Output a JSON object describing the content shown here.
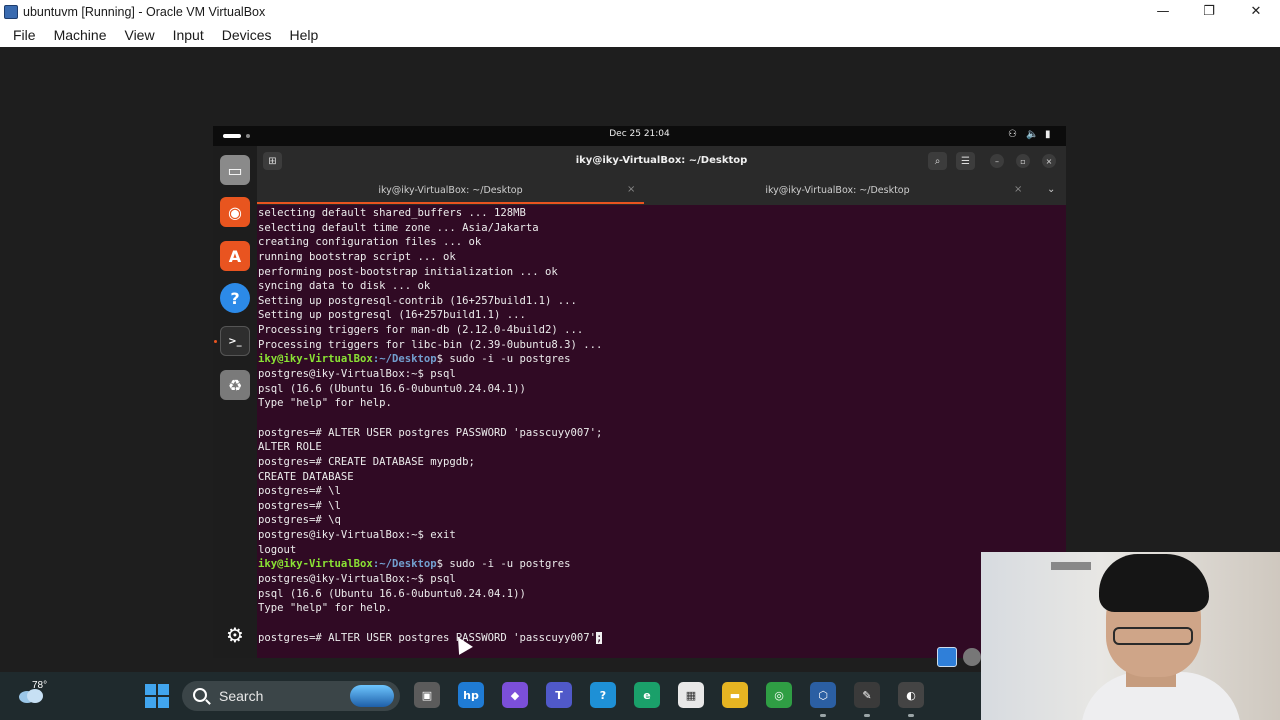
{
  "window": {
    "title": "ubuntuvm [Running] - Oracle VM VirtualBox",
    "minimize": "—",
    "restore": "❐",
    "close": "✕"
  },
  "menu": {
    "items": [
      "File",
      "Machine",
      "View",
      "Input",
      "Devices",
      "Help"
    ]
  },
  "ubuntu_topbar": {
    "clock": "Dec 25  21:04"
  },
  "terminal": {
    "title": "iky@iky-VirtualBox: ~/Desktop",
    "tabs": [
      {
        "label": "iky@iky-VirtualBox: ~/Desktop",
        "active": true
      },
      {
        "label": "iky@iky-VirtualBox: ~/Desktop",
        "active": false
      }
    ],
    "new_tab_icon": "⊞",
    "search_icon": "⌕",
    "menu_icon": "☰",
    "tabs_dropdown_icon": "⌄",
    "tab_close": "×",
    "lines": [
      {
        "text": "selecting default shared_buffers ... 128MB"
      },
      {
        "text": "selecting default time zone ... Asia/Jakarta"
      },
      {
        "text": "creating configuration files ... ok"
      },
      {
        "text": "running bootstrap script ... ok"
      },
      {
        "text": "performing post-bootstrap initialization ... ok"
      },
      {
        "text": "syncing data to disk ... ok"
      },
      {
        "text": "Setting up postgresql-contrib (16+257build1.1) ..."
      },
      {
        "text": "Setting up postgresql (16+257build1.1) ..."
      },
      {
        "text": "Processing triggers for man-db (2.12.0-4build2) ..."
      },
      {
        "text": "Processing triggers for libc-bin (2.39-0ubuntu8.3) ..."
      },
      {
        "user": "iky@iky-VirtualBox",
        "path": ":~/Desktop",
        "text": "$ sudo -i -u postgres"
      },
      {
        "text": "postgres@iky-VirtualBox:~$ psql"
      },
      {
        "text": "psql (16.6 (Ubuntu 16.6-0ubuntu0.24.04.1))"
      },
      {
        "text": "Type \"help\" for help."
      },
      {
        "text": ""
      },
      {
        "text": "postgres=# ALTER USER postgres PASSWORD 'passcuyy007';"
      },
      {
        "text": "ALTER ROLE"
      },
      {
        "text": "postgres=# CREATE DATABASE mypgdb;"
      },
      {
        "text": "CREATE DATABASE"
      },
      {
        "text": "postgres=# \\l"
      },
      {
        "text": "postgres=# \\l"
      },
      {
        "text": "postgres=# \\q"
      },
      {
        "text": "postgres@iky-VirtualBox:~$ exit"
      },
      {
        "text": "logout"
      },
      {
        "user": "iky@iky-VirtualBox",
        "path": ":~/Desktop",
        "text": "$ sudo -i -u postgres"
      },
      {
        "text": "postgres@iky-VirtualBox:~$ psql"
      },
      {
        "text": "psql (16.6 (Ubuntu 16.6-0ubuntu0.24.04.1))"
      },
      {
        "text": "Type \"help\" for help."
      },
      {
        "text": ""
      },
      {
        "text": "postgres=# ALTER USER postgres PASSWORD 'passcuyy007'",
        "cursor": ";"
      }
    ]
  },
  "dock": {
    "items": [
      {
        "name": "files",
        "glyph": "▭",
        "color": "#8a8a8a"
      },
      {
        "name": "firefox",
        "glyph": "◉",
        "color": "#e8551f"
      },
      {
        "name": "app-center",
        "glyph": "A",
        "color": "#e95420"
      },
      {
        "name": "help",
        "glyph": "?",
        "color": "#2c8ae8"
      },
      {
        "name": "terminal",
        "glyph": ">_",
        "color": "#2e2e2e"
      },
      {
        "name": "trash",
        "glyph": "♻",
        "color": "#7a7a7a"
      }
    ],
    "show_apps_glyph": "⚙"
  },
  "taskbar": {
    "weather_temp": "78°",
    "search_label": "Search",
    "apps": [
      {
        "name": "file-manager-icon",
        "glyph": "▣",
        "color": "#5b5b5b"
      },
      {
        "name": "mhp-icon",
        "glyph": "hp",
        "color": "#1f7bd4"
      },
      {
        "name": "copilot-icon",
        "glyph": "◆",
        "color": "#7b4fd9"
      },
      {
        "name": "teams-icon",
        "glyph": "T",
        "color": "#5059c9"
      },
      {
        "name": "help-icon",
        "glyph": "?",
        "color": "#1e90d6"
      },
      {
        "name": "edge-icon",
        "glyph": "e",
        "color": "#1aa06a"
      },
      {
        "name": "store-icon",
        "glyph": "▦",
        "color": "#e8e8e8"
      },
      {
        "name": "explorer-icon",
        "glyph": "▬",
        "color": "#e6b422"
      },
      {
        "name": "chrome-icon",
        "glyph": "◎",
        "color": "#2f9e44"
      },
      {
        "name": "virtualbox-icon",
        "glyph": "⬡",
        "color": "#2b5fa3"
      },
      {
        "name": "editor-icon",
        "glyph": "✎",
        "color": "#3a3a3a"
      },
      {
        "name": "obs-icon",
        "glyph": "◐",
        "color": "#444444"
      }
    ]
  }
}
